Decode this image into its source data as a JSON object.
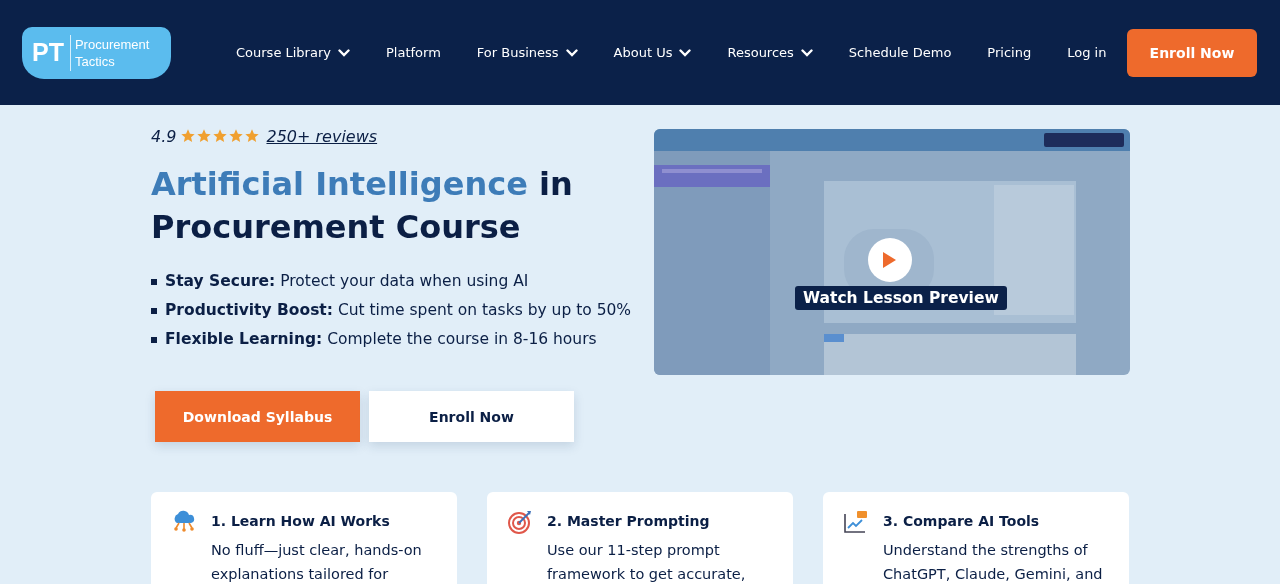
{
  "header": {
    "logo": {
      "mark": "PT",
      "name_line1": "Procurement",
      "name_line2": "Tactics"
    },
    "nav": [
      {
        "label": "Course Library",
        "has_menu": true
      },
      {
        "label": "Platform",
        "has_menu": false
      },
      {
        "label": "For Business",
        "has_menu": true
      },
      {
        "label": "About Us",
        "has_menu": true
      },
      {
        "label": "Resources",
        "has_menu": true
      },
      {
        "label": "Schedule Demo",
        "has_menu": false
      },
      {
        "label": "Pricing",
        "has_menu": false
      },
      {
        "label": "Log in",
        "has_menu": false
      }
    ],
    "cta": "Enroll Now"
  },
  "hero": {
    "rating": "4.9",
    "stars": 5,
    "reviews": "250+ reviews",
    "title": {
      "highlight": "Artificial Intelligence",
      "rest": "in Procurement Course"
    },
    "bullets": [
      {
        "lead": "Stay Secure:",
        "text": "Protect your data when using AI"
      },
      {
        "lead": "Productivity Boost:",
        "text": "Cut time spent on tasks by up to 50%"
      },
      {
        "lead": "Flexible Learning:",
        "text": "Complete the course in 8-16 hours"
      }
    ],
    "buttons": [
      {
        "label": "Download Syllabus",
        "kind": "primary"
      },
      {
        "label": "Enroll Now",
        "kind": "secondary"
      }
    ],
    "preview": {
      "kind": "picture",
      "label": "Watch Lesson Preview"
    }
  },
  "features": [
    {
      "title": "1. Learn How AI Works",
      "text": "No fluff—just clear, hands-on explanations tailored for"
    },
    {
      "title": "2. Master Prompting",
      "text": "Use our 11-step prompt framework to get accurate,"
    },
    {
      "title": "3. Compare AI Tools",
      "text": "Understand the strengths of ChatGPT, Claude, Gemini, and"
    }
  ]
}
